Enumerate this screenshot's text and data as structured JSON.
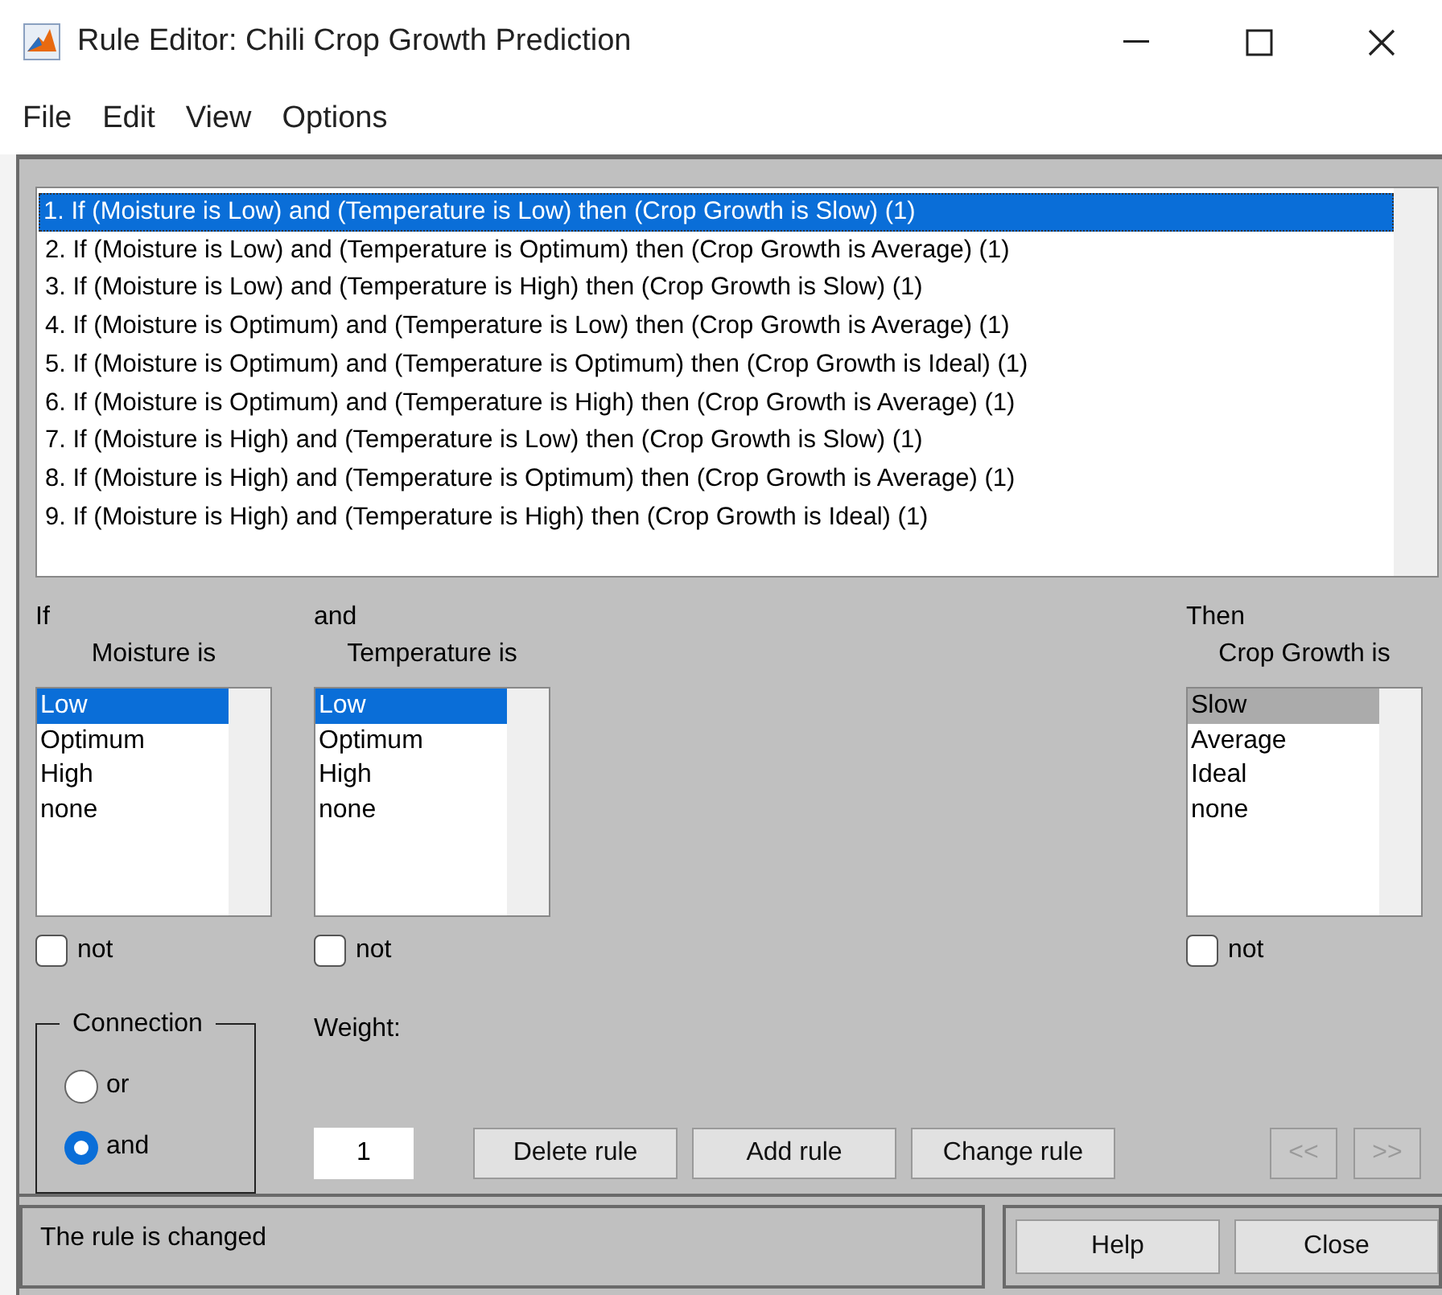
{
  "window": {
    "title": "Rule Editor: Chili Crop Growth Prediction"
  },
  "menu": [
    "File",
    "Edit",
    "View",
    "Options"
  ],
  "rules": [
    {
      "text": "1. If (Moisture is Low) and (Temperature is Low) then (Crop Growth is Slow) (1)",
      "selected": true
    },
    {
      "text": "2. If (Moisture is Low) and (Temperature is Optimum) then (Crop Growth is Average) (1)",
      "selected": false
    },
    {
      "text": "3. If (Moisture is Low) and (Temperature is High) then (Crop Growth is Slow) (1)",
      "selected": false
    },
    {
      "text": "4. If (Moisture is Optimum) and (Temperature is Low) then (Crop Growth is Average) (1)",
      "selected": false
    },
    {
      "text": "5. If (Moisture is Optimum) and (Temperature is Optimum) then (Crop Growth is Ideal) (1)",
      "selected": false
    },
    {
      "text": "6. If (Moisture is Optimum) and (Temperature is High) then (Crop Growth is Average) (1)",
      "selected": false
    },
    {
      "text": "7. If (Moisture is High) and (Temperature is Low) then (Crop Growth is Slow) (1)",
      "selected": false
    },
    {
      "text": "8. If (Moisture is High) and (Temperature is Optimum) then (Crop Growth is Average) (1)",
      "selected": false
    },
    {
      "text": "9. If (Moisture is High) and (Temperature is High) then (Crop Growth is Ideal) (1)",
      "selected": false
    }
  ],
  "variables": [
    {
      "kind": "input",
      "connector": "If",
      "label": "Moisture is",
      "focused": true,
      "options": [
        {
          "text": "Low",
          "selected": true
        },
        {
          "text": "Optimum",
          "selected": false
        },
        {
          "text": "High",
          "selected": false
        },
        {
          "text": "none",
          "selected": false
        }
      ],
      "negate": {
        "label": "not",
        "checked": false
      }
    },
    {
      "kind": "input",
      "connector": "and",
      "label": "Temperature is",
      "focused": true,
      "options": [
        {
          "text": "Low",
          "selected": true
        },
        {
          "text": "Optimum",
          "selected": false
        },
        {
          "text": "High",
          "selected": false
        },
        {
          "text": "none",
          "selected": false
        }
      ],
      "negate": {
        "label": "not",
        "checked": false
      }
    },
    {
      "kind": "output",
      "connector": "Then",
      "label": "Crop Growth is",
      "focused": false,
      "options": [
        {
          "text": "Slow",
          "selected": true
        },
        {
          "text": "Average",
          "selected": false
        },
        {
          "text": "Ideal",
          "selected": false
        },
        {
          "text": "none",
          "selected": false
        }
      ],
      "negate": {
        "label": "not",
        "checked": false
      }
    }
  ],
  "connection": {
    "title": "Connection",
    "options": [
      {
        "label": "or",
        "selected": false
      },
      {
        "label": "and",
        "selected": true
      }
    ]
  },
  "weight": {
    "label": "Weight:",
    "value": "1"
  },
  "rule_buttons": [
    {
      "label": "Delete rule",
      "disabled": false
    },
    {
      "label": "Add rule",
      "disabled": false
    },
    {
      "label": "Change rule",
      "disabled": false
    }
  ],
  "nav_buttons": [
    {
      "label": "<<",
      "disabled": true
    },
    {
      "label": ">>",
      "disabled": true
    }
  ],
  "status": "The rule is changed",
  "dialog_buttons": [
    "Help",
    "Close"
  ]
}
